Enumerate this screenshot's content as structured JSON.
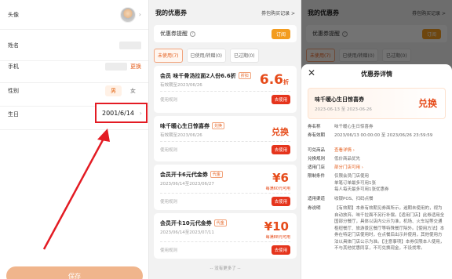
{
  "profile": {
    "rows": [
      {
        "label": "头像"
      },
      {
        "label": "姓名"
      },
      {
        "label": "手机",
        "action": "更换"
      },
      {
        "label": "性别",
        "options": [
          "男",
          "女"
        ],
        "selected": "男"
      },
      {
        "label": "生日",
        "value": "2001/6/14"
      }
    ],
    "save_label": "保存"
  },
  "coupons": {
    "title": "我的优惠券",
    "link": "券包购买记录 >",
    "remind_label": "优惠券提醒",
    "remind_switch": "订阅",
    "tabs": [
      "未使用(7)",
      "已使用/转赠(0)",
      "已过期(0)"
    ],
    "items": [
      {
        "title": "会员 味千骨汤拉面2人份6.6折",
        "tag": "折扣",
        "date": "有效期至2023/06/26",
        "value": "6.6",
        "unit": "折",
        "use": "使用规则",
        "btn": "去使用"
      },
      {
        "title": "味千暖心生日惊喜券",
        "tag": "兑换",
        "date": "有效期至2023/06/26",
        "value": "兑换",
        "use": "使用规则",
        "btn": "去使用"
      },
      {
        "title": "会员开卡6元代金券",
        "tag": "代金",
        "date": "2023/06/14至2023/06/27",
        "value": "¥6",
        "sub": "每满60元可用",
        "use": "使用规则",
        "btn": "去使用"
      },
      {
        "title": "会员开卡10元代金券",
        "tag": "代金",
        "date": "2023/06/14至2023/07/11",
        "value": "¥10",
        "sub": "每满88元可用",
        "use": "使用规则",
        "btn": "去使用"
      }
    ],
    "no_more": "-- 没有更多了 --"
  },
  "detail": {
    "title": "优惠券详情",
    "close": "✕",
    "coupon_title": "味千暖心生日惊喜券",
    "coupon_dates": "2023-06-13 至 2023-06-26",
    "coupon_value": "兑换",
    "fields": [
      {
        "k": "券名称",
        "v": "味千暖心生日惊喜券"
      },
      {
        "k": "券有效期",
        "v": "2023/06/13 00:00:00 至 2023/06/26 23:59:59"
      },
      {
        "k": "可兑商品",
        "v": "查看详情 ›",
        "orange": true
      },
      {
        "k": "兑换规则",
        "v": "低价商品优先"
      },
      {
        "k": "适用门店",
        "v": "部分门店可用 ›",
        "orange": true
      },
      {
        "k": "限制条件",
        "v": "仅限会员门店使用\n单笔订单最多可用1张\n每人每天最多可用1张优惠券"
      },
      {
        "k": "适用渠道",
        "v": "收银POS、扫码点餐"
      },
      {
        "k": "券说明",
        "v": "【有效期】本券有效期见券面所示，逾期未使用的，视为自动放弃。味千拉面不另行补偿。【适用门店】此券适用全国部分餐厅，具体以店内公示为准，机场、火车站等交通枢纽餐厅、旅游景区餐厅等特殊餐厅除外。【使用方法】本券在特定门店使用时，在点餐后出示并使用，其他使用方法以具体门店公示为准。【注意事项】本券仅限本人使用，不与其他优惠同享，不可兑换现金，不设找零。"
      }
    ]
  }
}
